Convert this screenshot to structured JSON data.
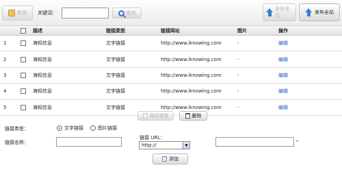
{
  "toolbar": {
    "new_label": "新建",
    "keyword_label": "关键词：",
    "keyword_value": "",
    "search_label": "查询",
    "publish_page_label": "发布该页",
    "publish_site_label": "发布全站"
  },
  "table": {
    "headers": {
      "desc": "描述",
      "type": "链接类型",
      "url": "链接网址",
      "image": "图片",
      "op": "操作"
    },
    "rows": [
      {
        "num": "1",
        "desc": "海知信息",
        "type": "文字链接",
        "url": "http://www.iknowing.com",
        "image": "-",
        "op": "编辑"
      },
      {
        "num": "2",
        "desc": "海知信息",
        "type": "文字链接",
        "url": "http://www.iknowing.com",
        "image": "-",
        "op": "编辑"
      },
      {
        "num": "3",
        "desc": "海知信息",
        "type": "文字链接",
        "url": "http://www.iknowing.com",
        "image": "-",
        "op": "编辑"
      },
      {
        "num": "4",
        "desc": "海知信息",
        "type": "文字链接",
        "url": "http://www.iknowing.com",
        "image": "-",
        "op": "编辑"
      },
      {
        "num": "5",
        "desc": "海知信息",
        "type": "文字链接",
        "url": "http://www.iknowing.com",
        "image": "-",
        "op": "编辑"
      }
    ]
  },
  "actions": {
    "save_order_label": "保存顺序",
    "delete_label": "删除"
  },
  "form": {
    "link_type_label": "链接类型：",
    "option_text": "文字链接",
    "option_image": "图片链接",
    "selected_option": "文字链接",
    "link_name_label": "链接名称：",
    "link_url_label": "链接 URL：",
    "url_prefix_value": "http://",
    "required_mark": "*",
    "add_label": "添加"
  },
  "colors": {
    "link": "#1b58b8",
    "required": "#dd2222",
    "header_bg": "#e3e3e3"
  }
}
